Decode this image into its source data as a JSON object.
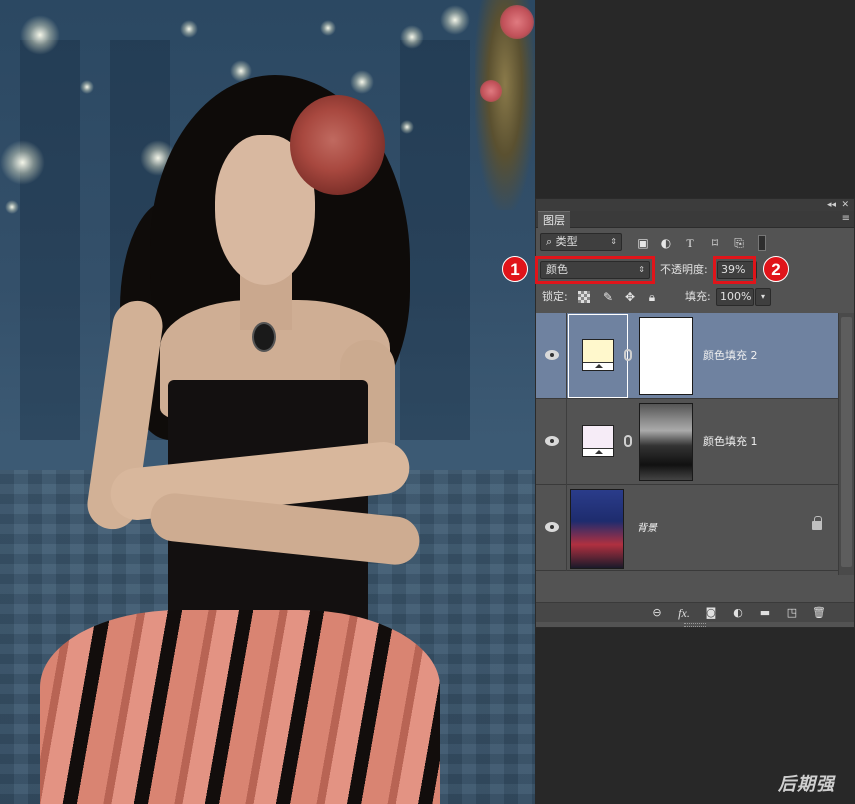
{
  "canvas": {
    "watermark": "后期强"
  },
  "panel": {
    "collapse_label": "◂◂",
    "close_label": "✕",
    "tab_label": "图层",
    "menu_icon": "≡",
    "filter": {
      "search_glyph": "⌕",
      "kind_value": "类型",
      "icons": [
        "image-filter-icon",
        "adjustment-filter-icon",
        "type-filter-icon",
        "shape-filter-icon",
        "smart-object-filter-icon",
        "filter-toggle-icon"
      ]
    },
    "blend_mode": "颜色",
    "opacity_label": "不透明度:",
    "opacity_value": "39%",
    "lock_label": "锁定:",
    "fill_label": "填充:",
    "fill_value": "100%",
    "annotations": [
      "1",
      "2"
    ],
    "layers": [
      {
        "name": "颜色填充 2",
        "selected": true,
        "fill_color": "#fff8cc",
        "mask": "white"
      },
      {
        "name": "颜色填充 1",
        "selected": false,
        "fill_color": "#f6ecf7",
        "mask": "portrait"
      },
      {
        "name": "背景",
        "selected": false,
        "locked": true
      }
    ],
    "bottom_icons": [
      "link-layers-icon",
      "fx-icon",
      "add-mask-icon",
      "new-adjustment-icon",
      "new-group-icon",
      "new-layer-icon",
      "delete-icon"
    ],
    "fx_label": "fx."
  },
  "colors": {
    "highlight": "#e0141a",
    "selected_layer": "#6f82a0",
    "panel_bg": "#535353"
  }
}
